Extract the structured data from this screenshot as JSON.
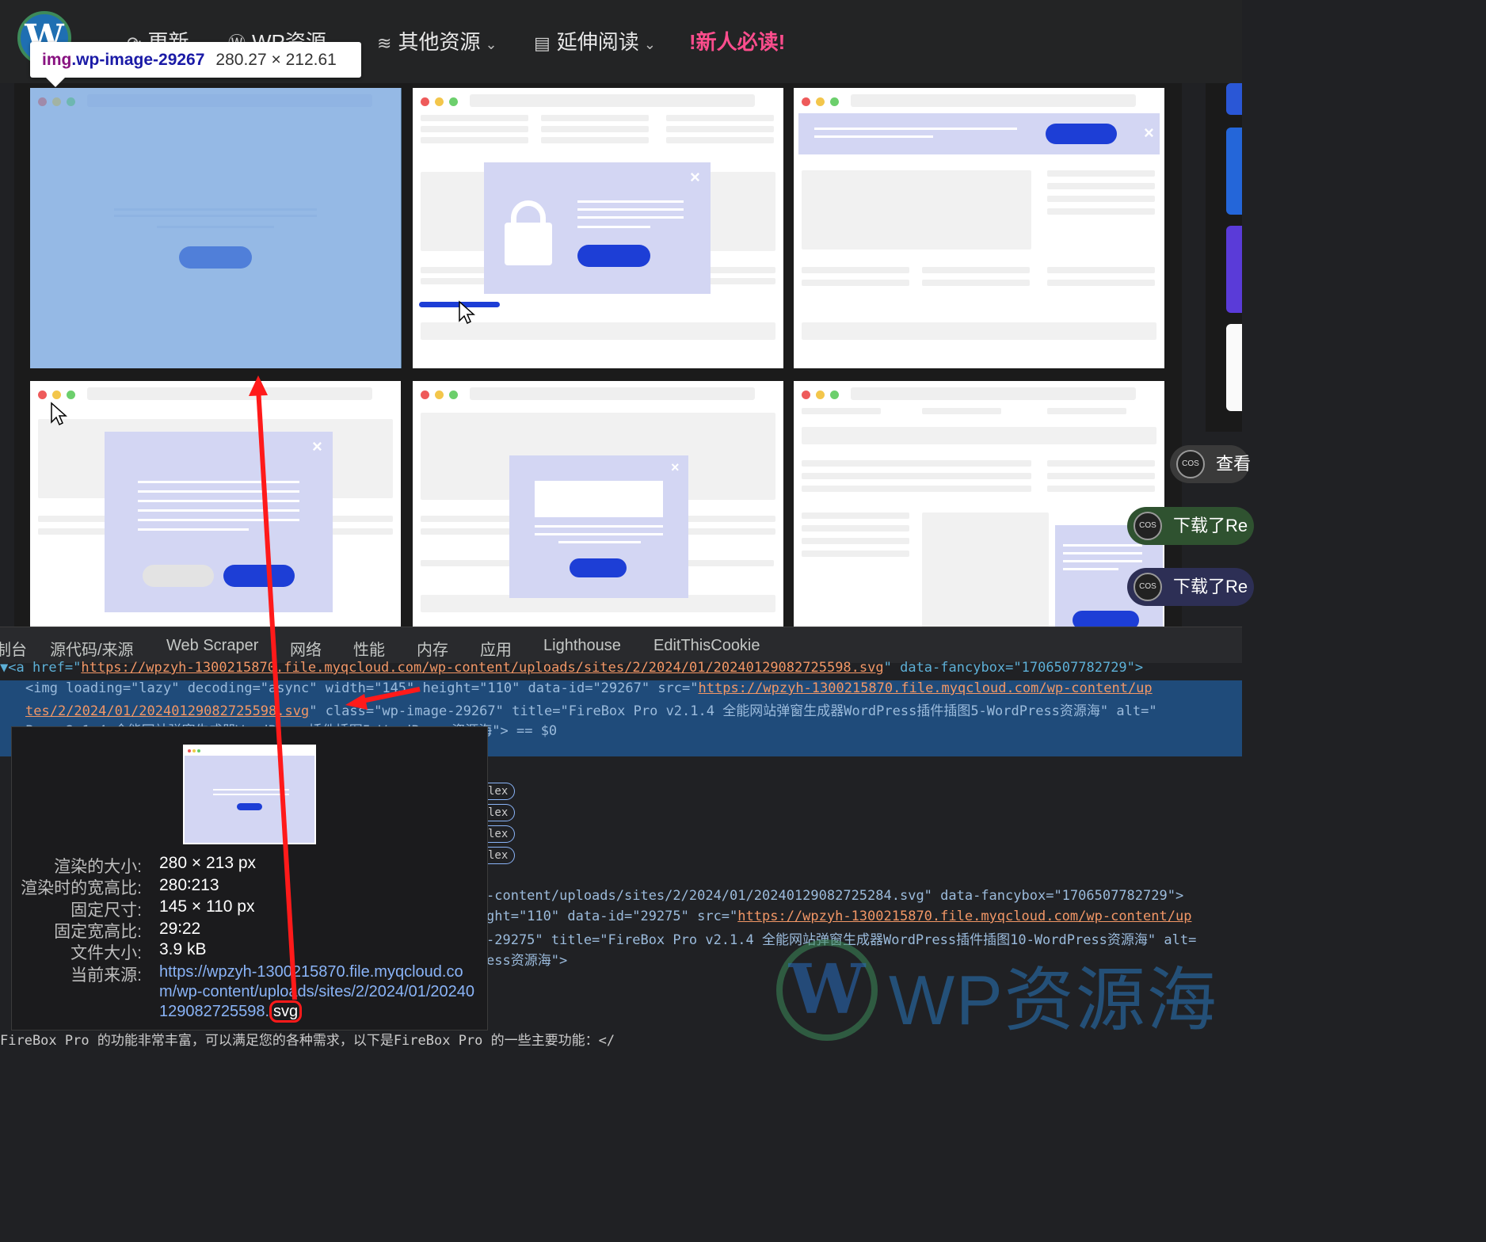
{
  "nav": {
    "items": [
      {
        "label": "更新",
        "icon": "refresh-icon"
      },
      {
        "label": "WP资源",
        "icon": "wordpress-icon"
      },
      {
        "label": "其他资源",
        "icon": "layers-icon"
      },
      {
        "label": "延伸阅读",
        "icon": "document-icon"
      }
    ],
    "hot": "!新人必读!"
  },
  "image_tooltip": {
    "tag": "img",
    "cls": ".wp-image-29267",
    "size": "280.27 × 212.61"
  },
  "side_chips": [
    {
      "avatar": "COS",
      "text": "查看"
    },
    {
      "avatar": "COS",
      "text": "下载了Re"
    },
    {
      "avatar": "COS",
      "text": "下载了Re"
    }
  ],
  "devtools": {
    "tabs": [
      "制台",
      "源代码/来源",
      "Web Scraper",
      "网络",
      "性能",
      "内存",
      "应用",
      "Lighthouse",
      "EditThisCookie"
    ],
    "line0": {
      "prefix": "▼<a href=\"",
      "url": "https://wpzyh-1300215870.file.myqcloud.com/wp-content/uploads/sites/2/2024/01/20240129082725598.svg",
      "suffix": "\" data-fancybox=\"1706507782729\">"
    },
    "line1": "<img loading=\"lazy\" decoding=\"async\" width=\"145\" height=\"110\" data-id=\"29267\" src=\"",
    "line1_url": "https://wpzyh-1300215870.file.myqcloud.com/wp-content/up",
    "line2_url": "tes/2/2024/01/20240129082725598.svg",
    "line2_rest": "\" class=\"wp-image-29267\" title=\"FireBox Pro v2.1.4 全能网站弹窗生成器WordPress插件插图5-WordPress资源海\" alt=\"",
    "line3": "Pro v2.1.4 全能网站弹窗生成器WordPress插件插图5-WordPress资源海\"> == $0",
    "flex_badge": "lex",
    "line_a": "-content/uploads/sites/2/2024/01/20240129082725284.svg\" data-fancybox=\"1706507782729\">",
    "line_b_pre": "ght=\"110\" data-id=\"29275\" src=\"",
    "line_b_url": "https://wpzyh-1300215870.file.myqcloud.com/wp-content/up",
    "line_c": "-29275\" title=\"FireBox Pro v2.1.4 全能网站弹窗生成器WordPress插件插图10-WordPress资源海\" alt=",
    "line_d": "ess资源海\">",
    "bottom": "FireBox Pro 的功能非常丰富，可以满足您的各种需求，以下是FireBox Pro 的一些主要功能：</"
  },
  "popup": {
    "rows": [
      {
        "k": "渲染的大小:",
        "v": "280 × 213 px"
      },
      {
        "k": "渲染时的宽高比:",
        "v": "280∶213"
      },
      {
        "k": "固定尺寸:",
        "v": "145 × 110 px"
      },
      {
        "k": "固定宽高比:",
        "v": "29∶22"
      },
      {
        "k": "文件大小:",
        "v": "3.9 kB"
      }
    ],
    "source_label": "当前来源:",
    "source_url": "https://wpzyh-1300215870.file.myqcloud.com/wp-content/uploads/sites/2/2024/01/20240129082725598.svg",
    "source_url_main": "https://wpzyh-1300215870.file.myqcloud.com/wp-content/uploads/sites/2/2024/01/20240129082725598.",
    "source_url_ext": "svg"
  },
  "watermark": "WP资源海",
  "annotation_color": "#ff1a1a"
}
